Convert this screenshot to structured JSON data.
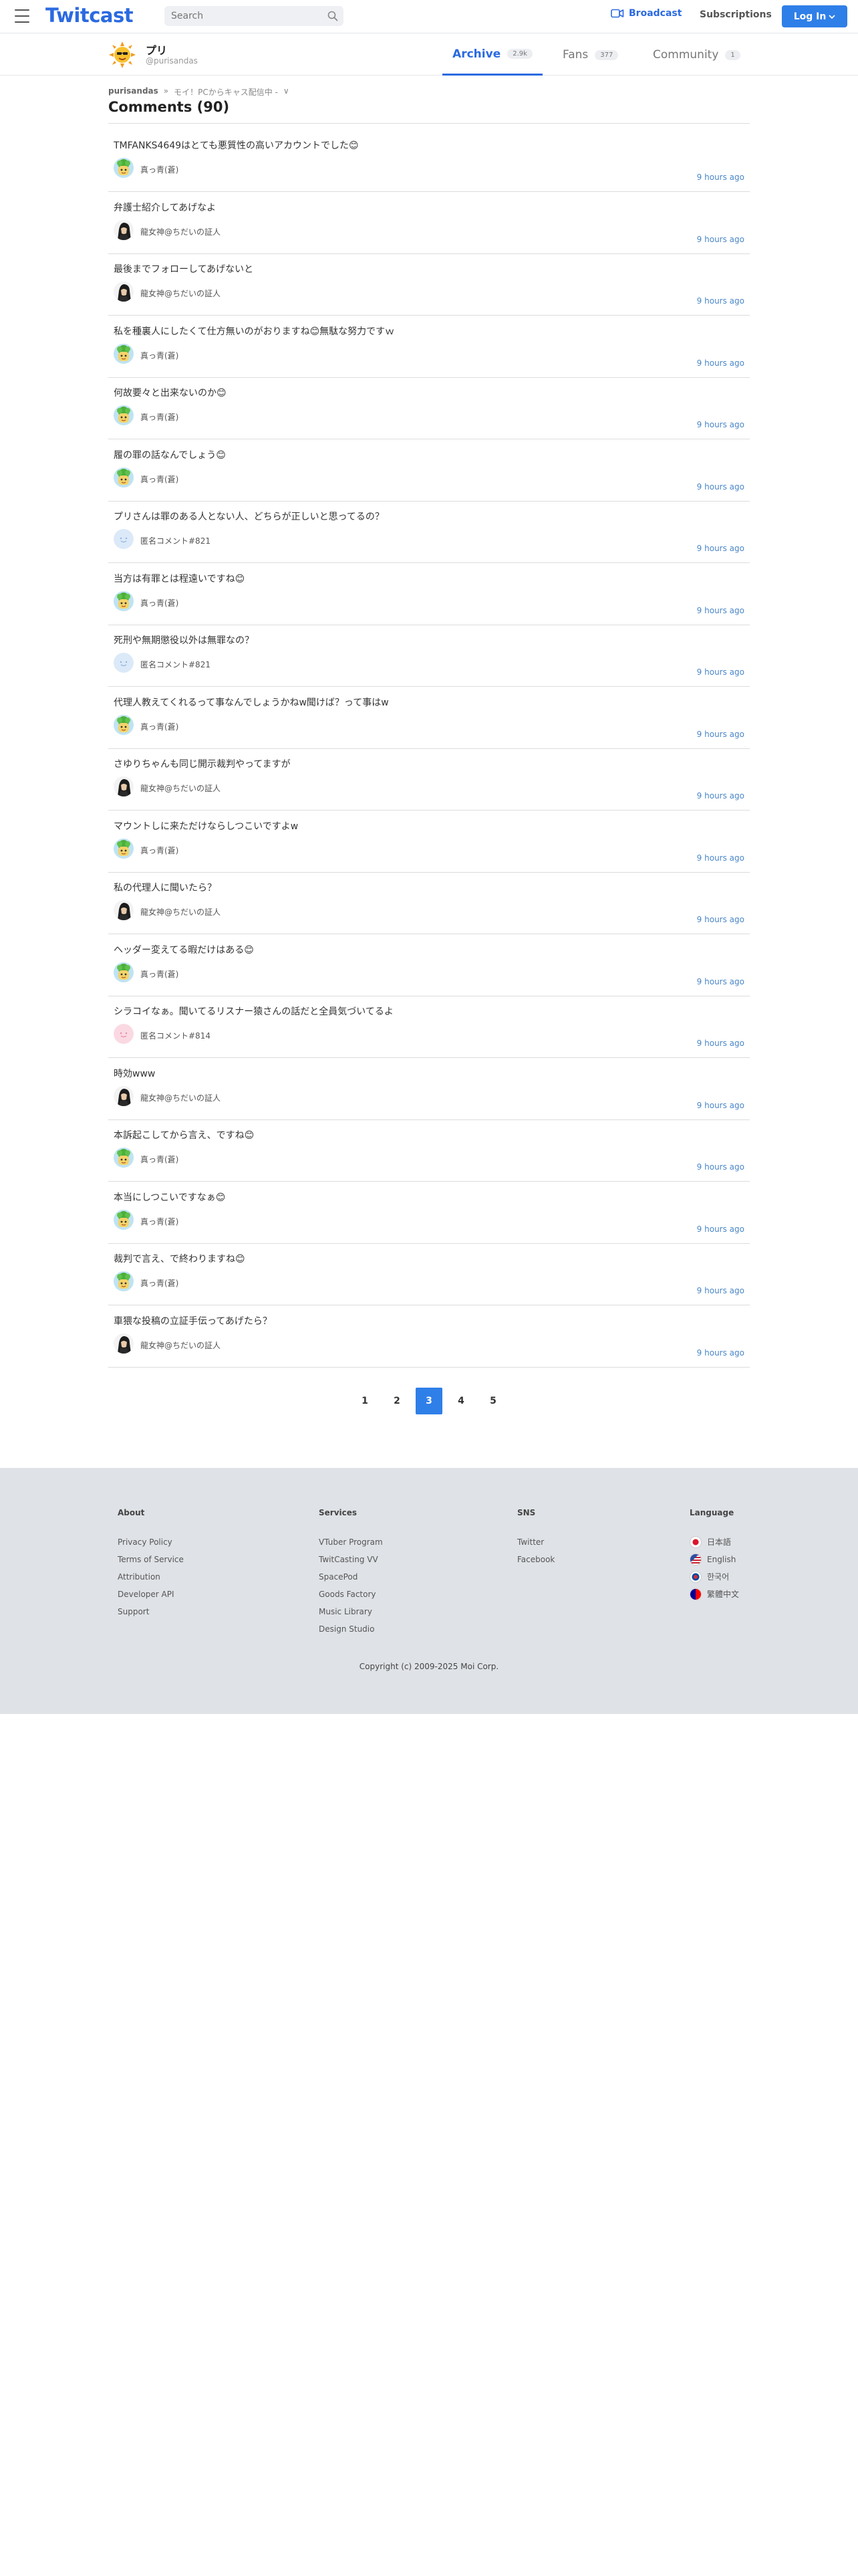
{
  "header": {
    "logo": "Twitcast",
    "search_placeholder": "Search",
    "broadcast_label": "Broadcast",
    "subscriptions_label": "Subscriptions",
    "login_label": "Log In"
  },
  "profile": {
    "name": "プリ",
    "id": "@purisandas",
    "tabs": [
      {
        "label": "Archive",
        "count": "2.9k",
        "active": true
      },
      {
        "label": "Fans",
        "count": "377",
        "active": false
      },
      {
        "label": "Community",
        "count": "1",
        "active": false
      }
    ]
  },
  "breadcrumb": {
    "user": "purisandas",
    "sep": "»",
    "movie": "モイ！PCからキャス配信中 -",
    "chevron": "∨"
  },
  "page_title": "Comments (90)",
  "comments": [
    {
      "text": "TMFANKS4649はとても悪質性の高いアカウントでした😊",
      "author": "真っ青(蒼)",
      "avatar": "green",
      "time": "9 hours ago"
    },
    {
      "text": "弁護士紹介してあげなよ",
      "author": "龍女神@ちだいの証人",
      "avatar": "dark",
      "time": "9 hours ago"
    },
    {
      "text": "最後までフォローしてあげないと",
      "author": "龍女神@ちだいの証人",
      "avatar": "dark",
      "time": "9 hours ago"
    },
    {
      "text": "私を種裏人にしたくて仕方無いのがおりますね😊無駄な努力ですｗ",
      "author": "真っ青(蒼)",
      "avatar": "green",
      "time": "9 hours ago"
    },
    {
      "text": "何故要々と出来ないのか😊",
      "author": "真っ青(蒼)",
      "avatar": "green",
      "time": "9 hours ago"
    },
    {
      "text": "履の罪の話なんでしょう😊",
      "author": "真っ青(蒼)",
      "avatar": "green",
      "time": "9 hours ago"
    },
    {
      "text": "プリさんは罪のある人とない人、どちらが正しいと思ってるの？",
      "author": "匿名コメント#821",
      "avatar": "anon-blue",
      "time": "9 hours ago"
    },
    {
      "text": "当方は有罪とは程遠いですね😊",
      "author": "真っ青(蒼)",
      "avatar": "green",
      "time": "9 hours ago"
    },
    {
      "text": "死刑や無期懲役以外は無罪なの？",
      "author": "匿名コメント#821",
      "avatar": "anon-blue",
      "time": "9 hours ago"
    },
    {
      "text": "代理人教えてくれるって事なんでしょうかねw聞けば？って事はw",
      "author": "真っ青(蒼)",
      "avatar": "green",
      "time": "9 hours ago"
    },
    {
      "text": "さゆりちゃんも同じ開示裁判やってますが",
      "author": "龍女神@ちだいの証人",
      "avatar": "dark",
      "time": "9 hours ago"
    },
    {
      "text": "マウントしに来ただけならしつこいですよw",
      "author": "真っ青(蒼)",
      "avatar": "green",
      "time": "9 hours ago"
    },
    {
      "text": "私の代理人に聞いたら？",
      "author": "龍女神@ちだいの証人",
      "avatar": "dark",
      "time": "9 hours ago"
    },
    {
      "text": "ヘッダー変えてる暇だけはある😊",
      "author": "真っ青(蒼)",
      "avatar": "green",
      "time": "9 hours ago"
    },
    {
      "text": "シラコイなぁ。聞いてるリスナー猿さんの話だと全員気づいてるよ",
      "author": "匿名コメント#814",
      "avatar": "anon-pink",
      "time": "9 hours ago"
    },
    {
      "text": "時効www",
      "author": "龍女神@ちだいの証人",
      "avatar": "dark",
      "time": "9 hours ago"
    },
    {
      "text": "本訴起こしてから言え、ですね😊",
      "author": "真っ青(蒼)",
      "avatar": "green",
      "time": "9 hours ago"
    },
    {
      "text": "本当にしつこいですなぁ😊",
      "author": "真っ青(蒼)",
      "avatar": "green",
      "time": "9 hours ago"
    },
    {
      "text": "裁判で言え、で終わりますね😊",
      "author": "真っ青(蒼)",
      "avatar": "green",
      "time": "9 hours ago"
    },
    {
      "text": "車猥な投稿の立証手伝ってあげたら？",
      "author": "龍女神@ちだいの証人",
      "avatar": "dark",
      "time": "9 hours ago"
    }
  ],
  "pagination": {
    "pages": [
      "1",
      "2",
      "3",
      "4",
      "5"
    ],
    "current": "3"
  },
  "footer": {
    "about": {
      "title": "About",
      "items": [
        "Privacy Policy",
        "Terms of Service",
        "Attribution",
        "Developer API",
        "Support"
      ]
    },
    "services": {
      "title": "Services",
      "items": [
        "VTuber Program",
        "TwitCasting VV",
        "SpacePod",
        "Goods Factory",
        "Music Library",
        "Design Studio"
      ]
    },
    "sns": {
      "title": "SNS",
      "items": [
        "Twitter",
        "Facebook"
      ]
    },
    "language": {
      "title": "Language",
      "items": [
        "日本語",
        "English",
        "한국어",
        "繁體中文"
      ]
    },
    "copyright": "Copyright (c) 2009-2025 Moi Corp."
  },
  "colors": {
    "brand": "#2b6ae0",
    "button": "#2f7fe8",
    "time": "#4a86c8",
    "footer_bg": "#dfe2e6"
  }
}
